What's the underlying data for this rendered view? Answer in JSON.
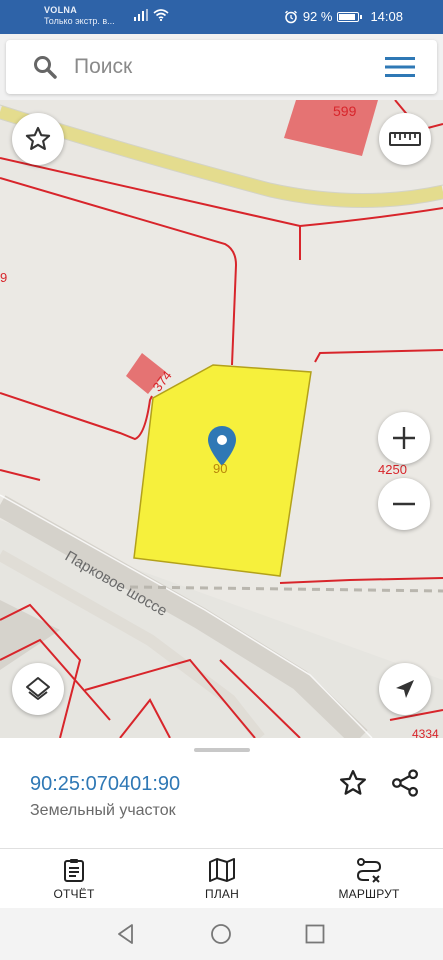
{
  "status_bar": {
    "carrier_name": "VOLNA",
    "carrier_note": "Только экстр. в...",
    "battery_text": "92 %",
    "battery_level": 0.92,
    "time": "14:08"
  },
  "search": {
    "placeholder": "Поиск"
  },
  "map": {
    "labels": {
      "parcel_599": "599",
      "parcel_374": "374",
      "parcel_selected": "90",
      "parcel_4250": "4250",
      "parcel_4334": "4334",
      "parcel_edge": "9",
      "street": "Парковое шоссе"
    },
    "colors": {
      "selected_fill": "#f6f03c",
      "parcel_border": "#d8252b",
      "building": "#e57373",
      "road_yellow": "#e8e08a",
      "pin": "#2f78b5"
    }
  },
  "parcel": {
    "cadastral_number": "90:25:070401:90",
    "type": "Земельный участок"
  },
  "bottom_nav": {
    "report_label": "ОТЧЁТ",
    "plan_label": "ПЛАН",
    "route_label": "МАРШРУТ"
  },
  "icons": [
    "search-icon",
    "menu-icon",
    "star-icon",
    "ruler-icon",
    "plus-icon",
    "minus-icon",
    "layers-icon",
    "navigation-arrow-icon",
    "share-icon",
    "clipboard-icon",
    "map-icon",
    "route-icon",
    "back-icon",
    "home-icon",
    "recents-icon",
    "map-pin-icon"
  ]
}
